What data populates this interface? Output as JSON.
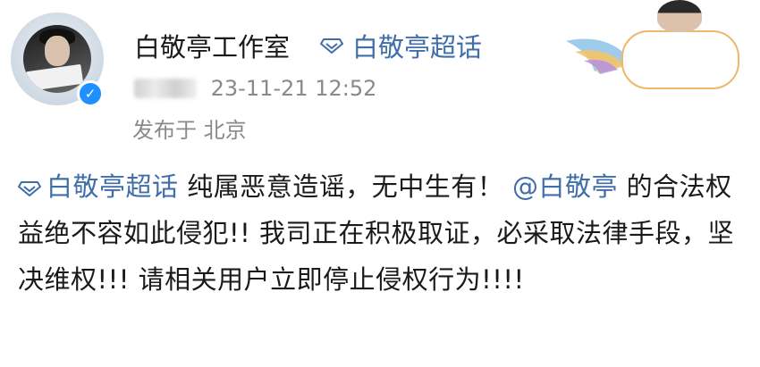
{
  "author": {
    "name": "白敬亭工作室",
    "supertopic_link": "白敬亭超话",
    "timestamp": "23-11-21 12:52",
    "location": "发布于 北京"
  },
  "body": {
    "topic": "白敬亭超话",
    "text1": " 纯属恶意造谣，无中生有！ ",
    "mention": "@白敬亭",
    "text2": " 的合法权益绝不容如此侵犯!! 我司正在积极取证，必采取法律手段，坚决维权!!! 请相关用户立即停止侵权行为!!!!"
  },
  "colors": {
    "link": "#3f6ea8",
    "text": "#1a1a1a",
    "meta": "#8a8a8a",
    "verified": "#1e90ff",
    "badge_border": "#f0b66a"
  },
  "icons": [
    "verified-icon",
    "supertopic-diamond-icon"
  ]
}
